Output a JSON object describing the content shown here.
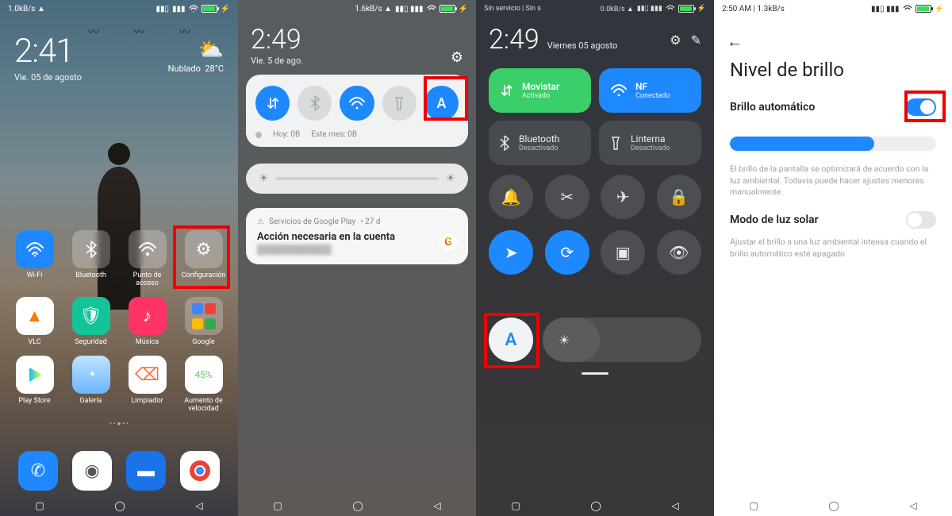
{
  "panel1": {
    "status_left": "1.0kB/s ▲",
    "clock": "2:41",
    "date": "Vie. 05 de agosto",
    "weather_cond": "Nublado",
    "weather_temp": "28°C",
    "apps_row1": [
      {
        "label": "Wi-Fi",
        "color": "#1e88ff",
        "glyph": "wifi"
      },
      {
        "label": "Bluetooth",
        "color": "frost",
        "glyph": "bt"
      },
      {
        "label": "Punto de acceso",
        "color": "frost",
        "glyph": "wifi"
      },
      {
        "label": "Configuración",
        "color": "frost",
        "glyph": "gear"
      }
    ],
    "apps_row2": [
      {
        "label": "VLC",
        "color": "#ff7a00",
        "glyph": "cone"
      },
      {
        "label": "Seguridad",
        "color": "#15c39a",
        "glyph": "shield"
      },
      {
        "label": "Música",
        "color": "#ff3366",
        "glyph": "note"
      },
      {
        "label": "Google",
        "color": "#fff",
        "glyph": "folder"
      }
    ],
    "apps_row3": [
      {
        "label": "Play Store",
        "color": "#fff",
        "glyph": "play"
      },
      {
        "label": "Galería",
        "color": "#69b6ff",
        "glyph": "gallery"
      },
      {
        "label": "Limpiador",
        "color": "#fff",
        "glyph": "broom"
      },
      {
        "label": "Aumento de velocidad",
        "color": "#fff",
        "glyph": "boost"
      }
    ]
  },
  "panel2": {
    "clock": "2:49",
    "date": "Vie. 5 de ago.",
    "status_net": "1.6kB/s ▲",
    "usage_today": "Hoy: 0B",
    "usage_month": "Este mes: 0B",
    "notif_source": "Servicios de Google Play",
    "notif_age": "• 27 d",
    "notif_title": "Acción necesaria en la cuenta"
  },
  "panel3": {
    "carrier": "Sin servicio | Sin s",
    "net": "0.0kB/s ▲",
    "clock": "2:49",
    "date": "Viernes 05 agosto",
    "tiles": [
      {
        "title": "Movistar",
        "sub": "Activado"
      },
      {
        "title": "NF",
        "sub": "Conectado"
      }
    ],
    "tiles2": [
      {
        "title": "Bluetooth",
        "sub": "Desactivado"
      },
      {
        "title": "Linterna",
        "sub": "Desactivado"
      }
    ]
  },
  "panel4": {
    "status_left": "2:50 AM | 1.3kB/s",
    "title": "Nivel de brillo",
    "row_auto": "Brillo automático",
    "desc1": "El brillo de la pantalla se optimizará de acuerdo con la luz ambiental. Todavía puede hacer ajustes menores manualmente.",
    "row_sun": "Modo de luz solar",
    "desc2": "Ajustar el brillo a una luz ambiental intensa cuando el brillo automático esté apagado"
  },
  "glyphs": {
    "wifi": "◖",
    "bt": "\"",
    "gear": "⚙",
    "A": "A",
    "sun": "☀"
  }
}
